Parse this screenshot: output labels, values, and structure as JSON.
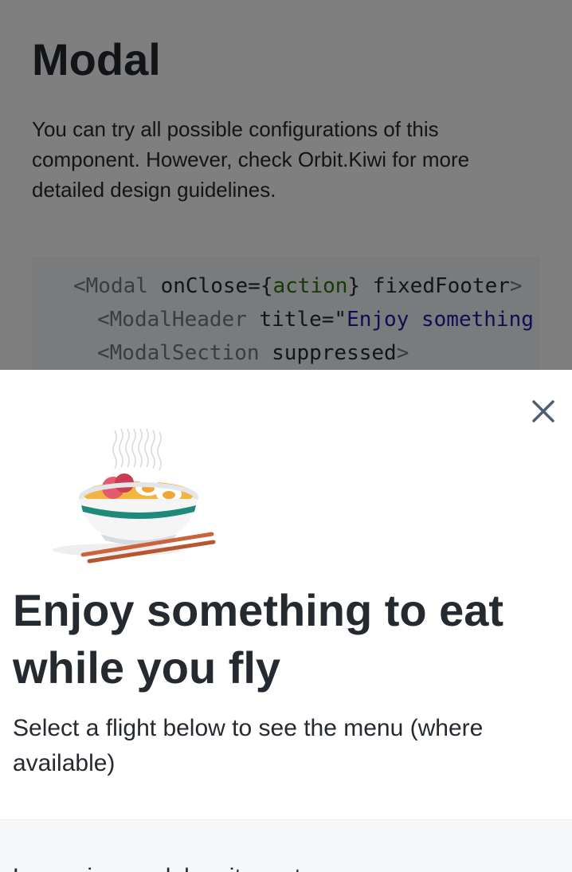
{
  "page": {
    "title": "Modal",
    "description": "You can try all possible configurations of this component. However, check Orbit.Kiwi for more detailed design guidelines."
  },
  "code": {
    "line1": {
      "open": "<",
      "tag": "Modal",
      "attr1": " onClose={",
      "action": "action",
      "attr2": "} fixedFooter",
      "close": ">"
    },
    "line2": {
      "open": "<",
      "tag": "ModalHeader",
      "attr": " title=\"",
      "value": "Enjoy something to eat while you fly"
    },
    "line3": {
      "open": "<",
      "tag": "ModalSection",
      "attr": " suppressed",
      "close": ">"
    }
  },
  "modal": {
    "close_icon": "close-icon",
    "illustration": "noodle-bowl-illustration",
    "title": "Enjoy something to eat while you fly",
    "description": "Select a flight below to see the menu (where available)",
    "section_text": "Lorem ipsum dolor sit amet"
  },
  "colors": {
    "text": "#252a31",
    "overlay": "rgba(0,0,0,0.5)",
    "suppressed_bg": "#f5f7f9",
    "close_icon": "#4f5e71"
  }
}
